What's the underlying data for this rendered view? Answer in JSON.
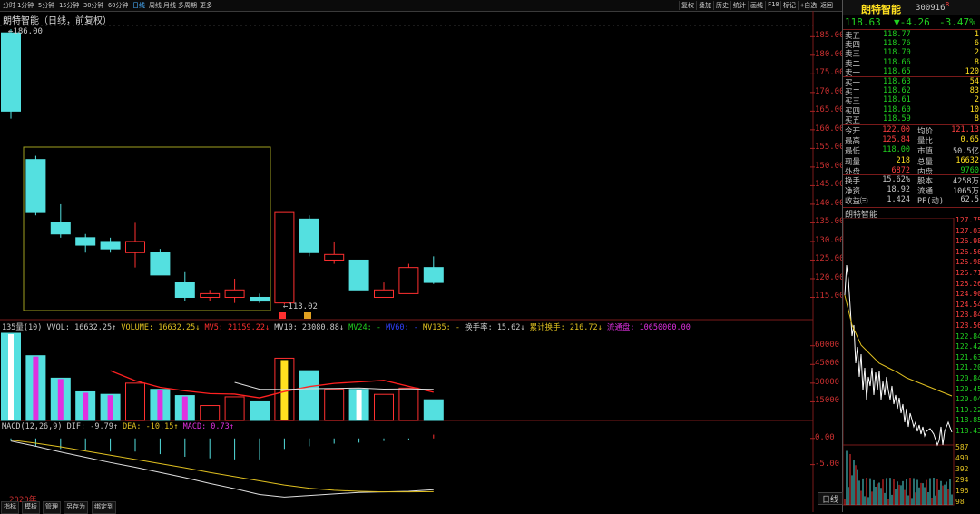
{
  "toolbar": {
    "periods": [
      "分时",
      "1分钟",
      "5分钟",
      "15分钟",
      "30分钟",
      "60分钟",
      "日线",
      "周线",
      "月线",
      "多周期",
      "更多"
    ],
    "active_period": "日线",
    "buttons": [
      "复权",
      "叠加",
      "历史",
      "统计",
      "画线",
      "F10",
      "标记",
      "+自选",
      "返回"
    ]
  },
  "chart_title": "朗特智能（日线，前复权）",
  "price_axis": [
    "185.00",
    "180.00",
    "175.00",
    "170.00",
    "165.00",
    "160.00",
    "155.00",
    "150.00",
    "145.00",
    "140.00",
    "135.00",
    "130.00",
    "125.00",
    "120.00",
    "115.00"
  ],
  "high_label": "186.00",
  "low_label": "113.02",
  "vol_axis": [
    "60000",
    "45000",
    "30000",
    "15000"
  ],
  "macd_axis": [
    "0.00",
    "-5.00"
  ],
  "year_label": "2020年",
  "chart_data": [
    {
      "type": "candlestick",
      "ylim": [
        110,
        188
      ],
      "candles": [
        {
          "o": 165,
          "c": 186,
          "h": 187,
          "l": 163,
          "up": false
        },
        {
          "o": 152,
          "c": 138,
          "h": 153,
          "l": 137,
          "up": false
        },
        {
          "o": 135,
          "c": 132,
          "h": 140,
          "l": 131,
          "up": false
        },
        {
          "o": 131,
          "c": 129,
          "h": 132,
          "l": 127,
          "up": false
        },
        {
          "o": 130,
          "c": 128,
          "h": 131,
          "l": 127,
          "up": false
        },
        {
          "o": 130,
          "c": 127,
          "h": 135,
          "l": 123,
          "up": true
        },
        {
          "o": 127,
          "c": 121,
          "h": 128,
          "l": 121,
          "up": false
        },
        {
          "o": 119,
          "c": 115,
          "h": 122,
          "l": 114,
          "up": false
        },
        {
          "o": 115,
          "c": 116,
          "h": 117,
          "l": 114,
          "up": true
        },
        {
          "o": 115,
          "c": 117,
          "h": 120,
          "l": 113.5,
          "up": true
        },
        {
          "o": 115,
          "c": 114,
          "h": 116,
          "l": 113.5,
          "up": false
        },
        {
          "o": 113.5,
          "c": 138,
          "h": 138,
          "l": 113.02,
          "up": true
        },
        {
          "o": 136,
          "c": 127,
          "h": 137,
          "l": 126,
          "up": false
        },
        {
          "o": 125,
          "c": 126.5,
          "h": 130,
          "l": 124,
          "up": true
        },
        {
          "o": 125,
          "c": 117,
          "h": 125,
          "l": 117,
          "up": false
        },
        {
          "o": 115,
          "c": 117,
          "h": 119,
          "l": 115,
          "up": true
        },
        {
          "o": 116,
          "c": 123,
          "h": 124,
          "l": 116,
          "up": true
        },
        {
          "o": 123,
          "c": 119,
          "h": 126,
          "l": 118.6,
          "up": false
        }
      ]
    },
    {
      "type": "bar",
      "name": "VOLUME",
      "ylim": [
        0,
        70000
      ],
      "values": [
        70000,
        52000,
        34000,
        23000,
        21000,
        30000,
        25000,
        20000,
        12000,
        19000,
        15000,
        50000,
        40000,
        25000,
        25000,
        21000,
        26000,
        16632
      ]
    },
    {
      "type": "bar",
      "name": "MACD",
      "ylim": [
        -12,
        1
      ],
      "values": [
        -0.5,
        -1.5,
        -2.0,
        -2.2,
        -2.5,
        -2.5,
        -3.0,
        -3.5,
        -3.8,
        -4.0,
        -4.0,
        -2.0,
        -1.5,
        -1.0,
        -0.8,
        -0.5,
        -0.3,
        0.73
      ]
    }
  ],
  "vol_header": [
    {
      "text": "135量(10) VVOL: 16632.25↑",
      "color": "#c8c8c8"
    },
    {
      "text": "VOLUME: 16632.25↓",
      "color": "#e0c020"
    },
    {
      "text": "MV5: 21159.22↓",
      "color": "#ff3030"
    },
    {
      "text": "MV10: 23080.88↓",
      "color": "#c8c8c8"
    },
    {
      "text": "MV24: -",
      "color": "#20d020"
    },
    {
      "text": "MV60: -",
      "color": "#3040ff"
    },
    {
      "text": "MV135: -",
      "color": "#e0c020"
    },
    {
      "text": "换手率: 15.62↓",
      "color": "#c8c8c8"
    },
    {
      "text": "累计换手: 216.72↓",
      "color": "#e0c020"
    },
    {
      "text": "流通盘: 10650000.00",
      "color": "#e030e0"
    }
  ],
  "macd_header": [
    {
      "text": "MACD(12,26,9) DIF: -9.79↑",
      "color": "#c8c8c8"
    },
    {
      "text": "DEA: -10.15↑",
      "color": "#e0c020"
    },
    {
      "text": "MACD: 0.73↑",
      "color": "#e030e0"
    }
  ],
  "bottom_tabs": [
    "指标",
    "模板",
    "管理",
    "另存为",
    "绑定到"
  ],
  "right_panel": {
    "name": "朗特智能",
    "code": "300916",
    "flag": "R",
    "price": "118.63",
    "change": "▼-4.26",
    "pct": "-3.47%",
    "asks": [
      {
        "label": "卖五",
        "price": "118.77",
        "vol": "1"
      },
      {
        "label": "卖四",
        "price": "118.76",
        "vol": "6"
      },
      {
        "label": "卖三",
        "price": "118.70",
        "vol": "2"
      },
      {
        "label": "卖二",
        "price": "118.66",
        "vol": "8"
      },
      {
        "label": "卖一",
        "price": "118.65",
        "vol": "120"
      }
    ],
    "bids": [
      {
        "label": "买一",
        "price": "118.63",
        "vol": "54"
      },
      {
        "label": "买二",
        "price": "118.62",
        "vol": "83"
      },
      {
        "label": "买三",
        "price": "118.61",
        "vol": "2"
      },
      {
        "label": "买四",
        "price": "118.60",
        "vol": "10"
      },
      {
        "label": "买五",
        "price": "118.59",
        "vol": "8"
      }
    ],
    "stats": [
      {
        "l1": "今开",
        "v1": "122.00",
        "c1": "#ff4040",
        "l2": "均价",
        "v2": "121.13",
        "c2": "#ff4040"
      },
      {
        "l1": "最高",
        "v1": "125.84",
        "c1": "#ff4040",
        "l2": "量比",
        "v2": "0.65",
        "c2": "#ffe020"
      },
      {
        "l1": "最低",
        "v1": "118.00",
        "c1": "#20d020",
        "l2": "市值",
        "v2": "50.5亿",
        "c2": "#c8c8c8"
      },
      {
        "l1": "现量",
        "v1": "218",
        "c1": "#ffe020",
        "l2": "总量",
        "v2": "16632",
        "c2": "#ffe020"
      },
      {
        "l1": "外盘",
        "v1": "6872",
        "c1": "#ff4040",
        "l2": "内盘",
        "v2": "9760",
        "c2": "#20d020"
      }
    ],
    "stats2": [
      {
        "l1": "换手",
        "v1": "15.62%",
        "l2": "股本",
        "v2": "4258万"
      },
      {
        "l1": "净资",
        "v1": "18.92",
        "l2": "流通",
        "v2": "1065万"
      },
      {
        "l1": "收益㈢",
        "v1": "1.424",
        "l2": "PE(动)",
        "v2": "62.5"
      }
    ],
    "mini_title": "朗特智能",
    "mini_axis": [
      "127.75",
      "127.03",
      "126.98",
      "126.56",
      "125.98",
      "125.71",
      "125.26",
      "124.90",
      "124.54",
      "123.84",
      "123.56",
      "122.84",
      "122.42",
      "121.63",
      "121.20",
      "120.84",
      "120.45",
      "120.04",
      "119.22",
      "118.85",
      "118.43"
    ],
    "mini_vol_axis": [
      "587",
      "490",
      "392",
      "294",
      "196",
      "98"
    ],
    "side_tab": "日线"
  }
}
